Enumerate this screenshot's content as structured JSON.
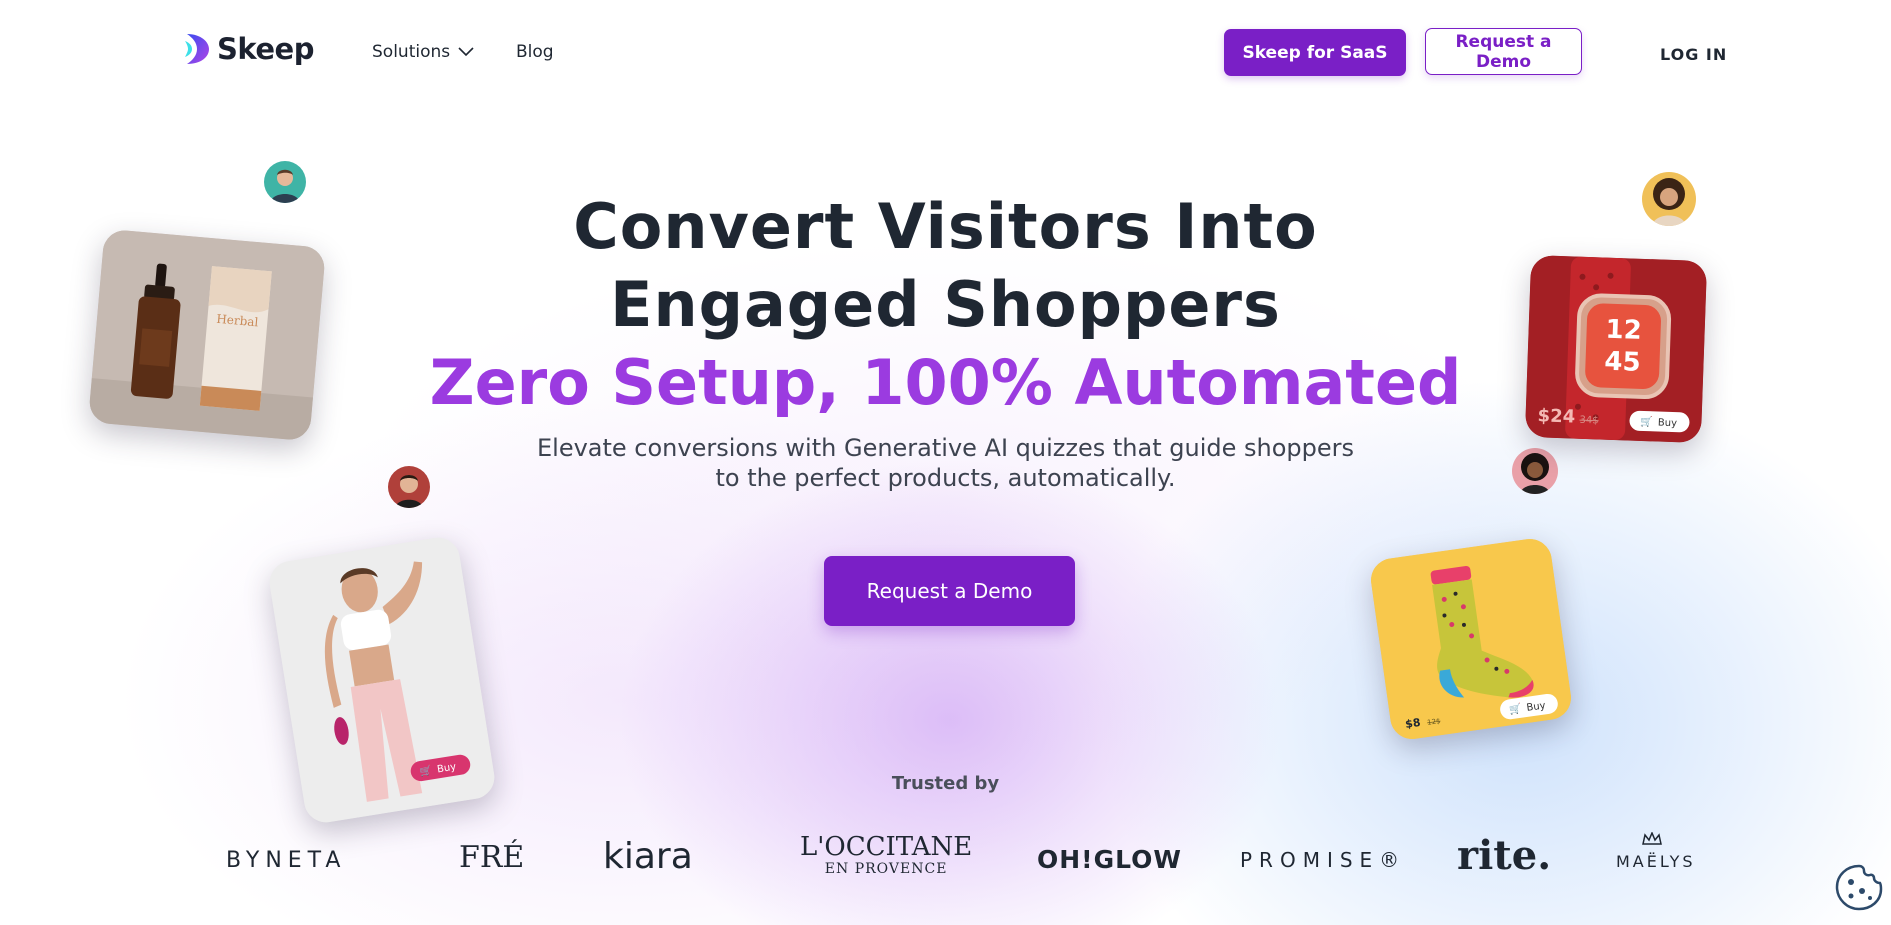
{
  "header": {
    "logo_text": "Skeep",
    "nav": {
      "solutions_label": "Solutions",
      "blog_label": "Blog"
    },
    "saas_button_label": "Skeep for SaaS",
    "demo_button_label": "Request a Demo",
    "login_label": "LOG IN"
  },
  "hero": {
    "title_line1": "Convert Visitors Into",
    "title_line2": "Engaged Shoppers",
    "title_accent": "Zero Setup, 100% Automated",
    "subtitle_line1": "Elevate conversions with Generative AI quizzes that guide shoppers",
    "subtitle_line2": "to the perfect products, automatically.",
    "cta_label": "Request a Demo"
  },
  "products": {
    "serum_label": "Herbal",
    "watch": {
      "time_top": "12",
      "time_bottom": "45",
      "price": "$24",
      "old_price": "34$",
      "buy_label": "Buy"
    },
    "woman": {
      "buy_label": "Buy"
    },
    "sock": {
      "price": "$8",
      "old_price": "12$",
      "buy_label": "Buy"
    }
  },
  "trusted": {
    "label": "Trusted by",
    "brands": [
      "BYNETA",
      "FRÉ",
      "kiara",
      "L'OCCITANE",
      "EN PROVENCE",
      "OH!GLOW",
      "PROMISE®",
      "rite.",
      "MAËLYS"
    ]
  },
  "colors": {
    "accent": "#7a1fc6",
    "accent_light": "#9b3be0",
    "text_dark": "#1f2732"
  },
  "icons": {
    "logo": "skeep-logo-icon",
    "solutions_chevron": "chevron-down-icon",
    "cart": "cart-icon",
    "cookie": "cookie-icon"
  }
}
